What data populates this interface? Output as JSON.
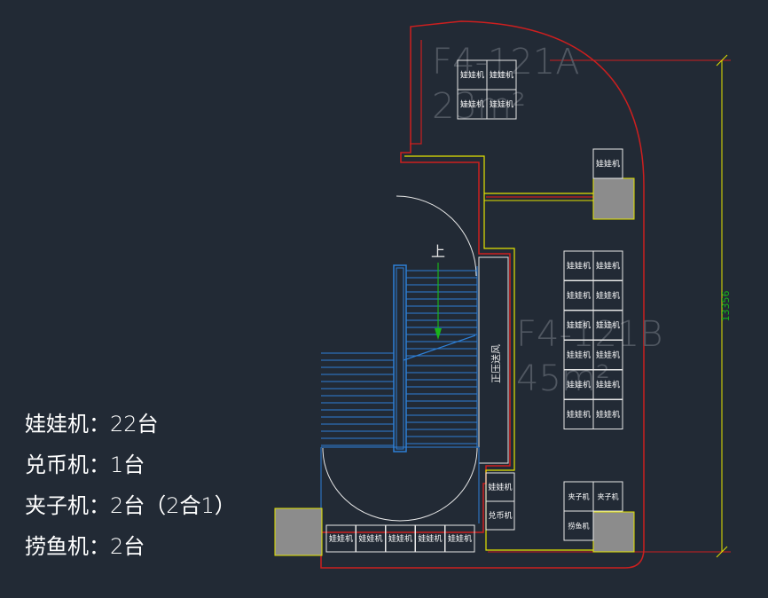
{
  "colors": {
    "background": "#222a35",
    "wall_red": "#cc1f1f",
    "wall_yellow": "#e4e400",
    "stair_blue": "#2d7fd6",
    "outline_white": "#e8e8e8",
    "machine_fill": "#8c8c8c",
    "dimension_green": "#19b419"
  },
  "rooms": [
    {
      "id": "F4-121A",
      "code": "F4-121A",
      "area": "23m²"
    },
    {
      "id": "F4-121B",
      "code": "F4-121B",
      "area": "45m²"
    }
  ],
  "dimension": {
    "value": "13356"
  },
  "stair": {
    "up_label": "上",
    "pressure_duct": "正压送风"
  },
  "machine_labels": {
    "doll": "娃娃机",
    "exchange": "兑币机",
    "clip": "夹子机",
    "fishing": "捞鱼机"
  },
  "legend": [
    {
      "text": "娃娃机：22台"
    },
    {
      "text": "兑币机：1台"
    },
    {
      "text": "夹子机：2台（2合1）"
    },
    {
      "text": "捞鱼机：2台"
    }
  ]
}
